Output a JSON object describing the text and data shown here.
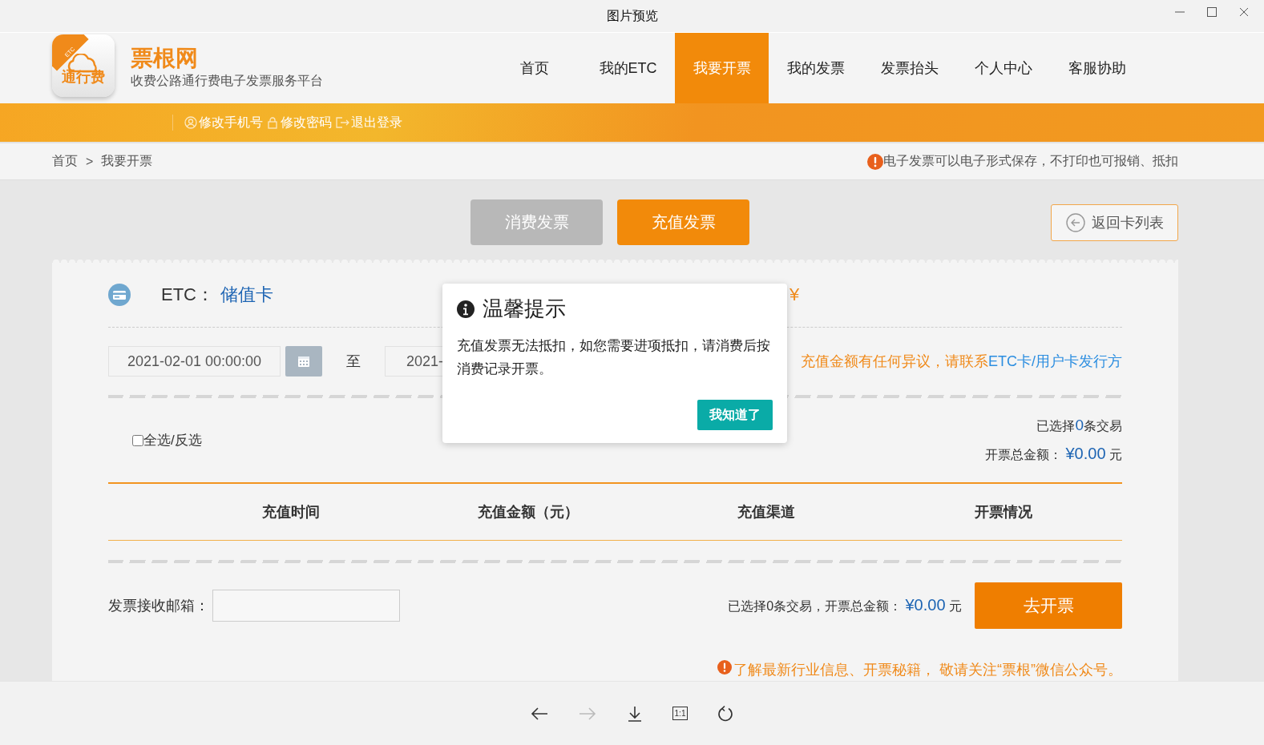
{
  "window": {
    "title": "图片预览"
  },
  "header": {
    "logo": {
      "corner": "ETC",
      "text": "通行费"
    },
    "brand": "票根网",
    "subtitle": "收费公路通行费电子发票服务平台",
    "nav": [
      {
        "label": "首页",
        "selected": false
      },
      {
        "label": "我的ETC",
        "selected": false
      },
      {
        "label": "我要开票",
        "selected": true
      },
      {
        "label": "我的发票",
        "selected": false
      },
      {
        "label": "发票抬头",
        "selected": false
      },
      {
        "label": "个人中心",
        "selected": false
      },
      {
        "label": "客服协助",
        "selected": false
      }
    ]
  },
  "user_bar": {
    "links": [
      {
        "kind": "phone",
        "label": "修改手机号"
      },
      {
        "kind": "lock",
        "label": "修改密码"
      },
      {
        "kind": "logout",
        "label": "退出登录"
      }
    ]
  },
  "breadcrumb": {
    "items": [
      "首页",
      "我要开票"
    ],
    "separator": ">",
    "notice": "电子发票可以电子形式保存，不打印也可报销、抵扣"
  },
  "invoice_tabs": [
    {
      "label": "消费发票",
      "selected": false
    },
    {
      "label": "充值发票",
      "selected": true
    }
  ],
  "back_button": "返回卡列表",
  "card": {
    "label": "ETC：",
    "number": "储值卡",
    "balance": "¥"
  },
  "filter": {
    "start": "2021-02-01 00:00:00",
    "to": "至",
    "end": "2021-",
    "hint": "充值金额有任何异议，请联系",
    "hint_link": "ETC卡/用户卡发行方"
  },
  "select_all": {
    "label": "全选/反选",
    "checked": false
  },
  "summary": {
    "selected_prefix": "已选择",
    "selected_count": "0",
    "selected_suffix": "条交易",
    "total_label": "开票总金额：",
    "total": "¥0.00",
    "unit": "元"
  },
  "table": {
    "columns": [
      "充值时间",
      "充值金额（元）",
      "充值渠道",
      "开票情况"
    ]
  },
  "footer": {
    "email_label": "发票接收邮箱：",
    "summary": "已选择0条交易，开票总金额：",
    "total": "¥0.00",
    "unit": "元",
    "submit": "去开票",
    "note": "了解最新行业信息、开票秘籍， 敬请关注“票根”微信公众号。"
  },
  "dialog": {
    "title": "温馨提示",
    "message": "充值发票无法抵扣，如您需要进项抵扣，请消费后按消费记录开票。",
    "button": "我知道了"
  },
  "viewer_toolbar": [
    {
      "kind": "back",
      "disabled": false
    },
    {
      "kind": "forward",
      "disabled": true
    },
    {
      "kind": "download",
      "disabled": false
    },
    {
      "kind": "actual",
      "label": "1:1",
      "disabled": false
    },
    {
      "kind": "rotate",
      "disabled": false
    }
  ]
}
